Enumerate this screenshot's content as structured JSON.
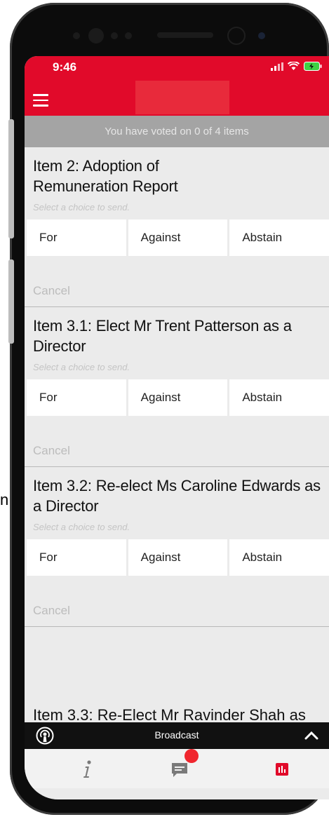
{
  "status_bar": {
    "time": "9:46"
  },
  "banner": {
    "text": "You have voted on 0 of 4 items"
  },
  "items": [
    {
      "title": "Item 2: Adoption of Remuneration Report",
      "hint": "Select a choice to send.",
      "choices": [
        "For",
        "Against",
        "Abstain"
      ],
      "cancel": "Cancel"
    },
    {
      "title": "Item 3.1: Elect Mr Trent Patterson as a Director",
      "hint": "Select a choice to send.",
      "choices": [
        "For",
        "Against",
        "Abstain"
      ],
      "cancel": "Cancel"
    },
    {
      "title": "Item 3.2: Re-elect Ms Caroline Edwards as a Director",
      "hint": "Select a choice to send.",
      "choices": [
        "For",
        "Against",
        "Abstain"
      ],
      "cancel": "Cancel"
    }
  ],
  "partial_item": {
    "title": "Item 3.3: Re-Elect Mr Ravinder Shah as"
  },
  "broadcast": {
    "label": "Broadcast"
  },
  "stray_text": "n",
  "colors": {
    "brand_red": "#e10a2a",
    "banner_gray": "#a4a4a4",
    "broadcast_bg": "#111111",
    "badge_red": "#f0262e"
  },
  "icons": {
    "menu": "hamburger-icon",
    "broadcast": "broadcast-icon",
    "expand": "chevron-up-icon",
    "info_tab": "info-icon",
    "chat_tab": "chat-icon",
    "results_tab": "bar-chart-icon"
  }
}
